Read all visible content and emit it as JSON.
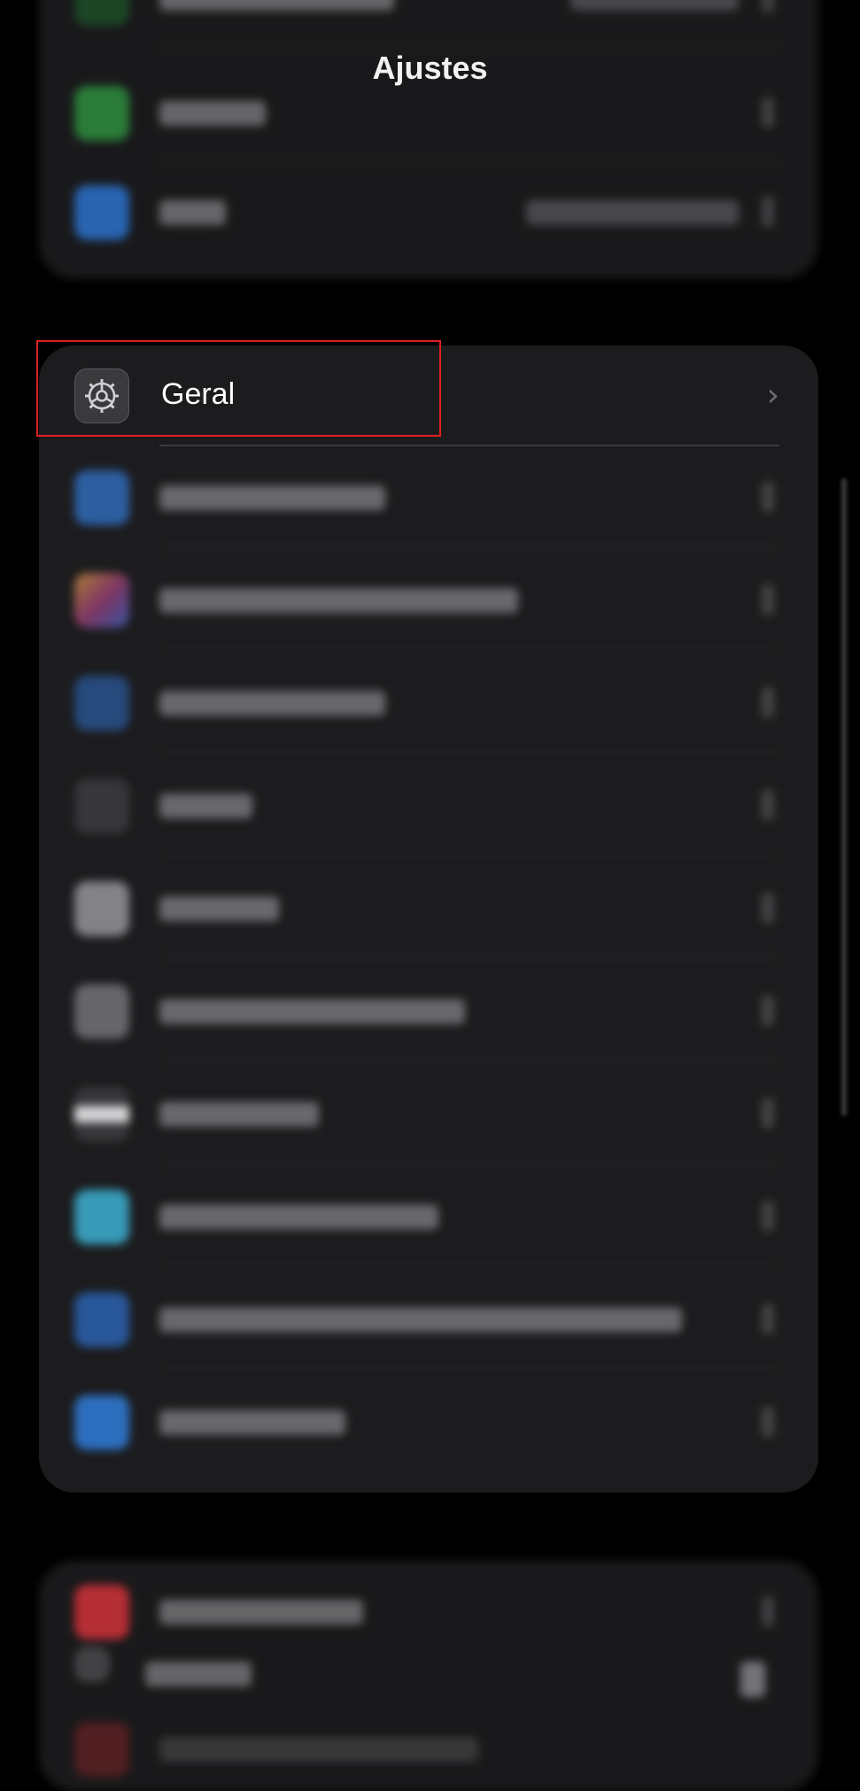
{
  "header": {
    "title": "Ajustes"
  },
  "selected_row": {
    "label": "Geral",
    "chevron": "›",
    "icon": "gear-icon"
  },
  "colors": {
    "highlight": "#e02020",
    "background": "#000000",
    "group": "#1c1c1e"
  }
}
